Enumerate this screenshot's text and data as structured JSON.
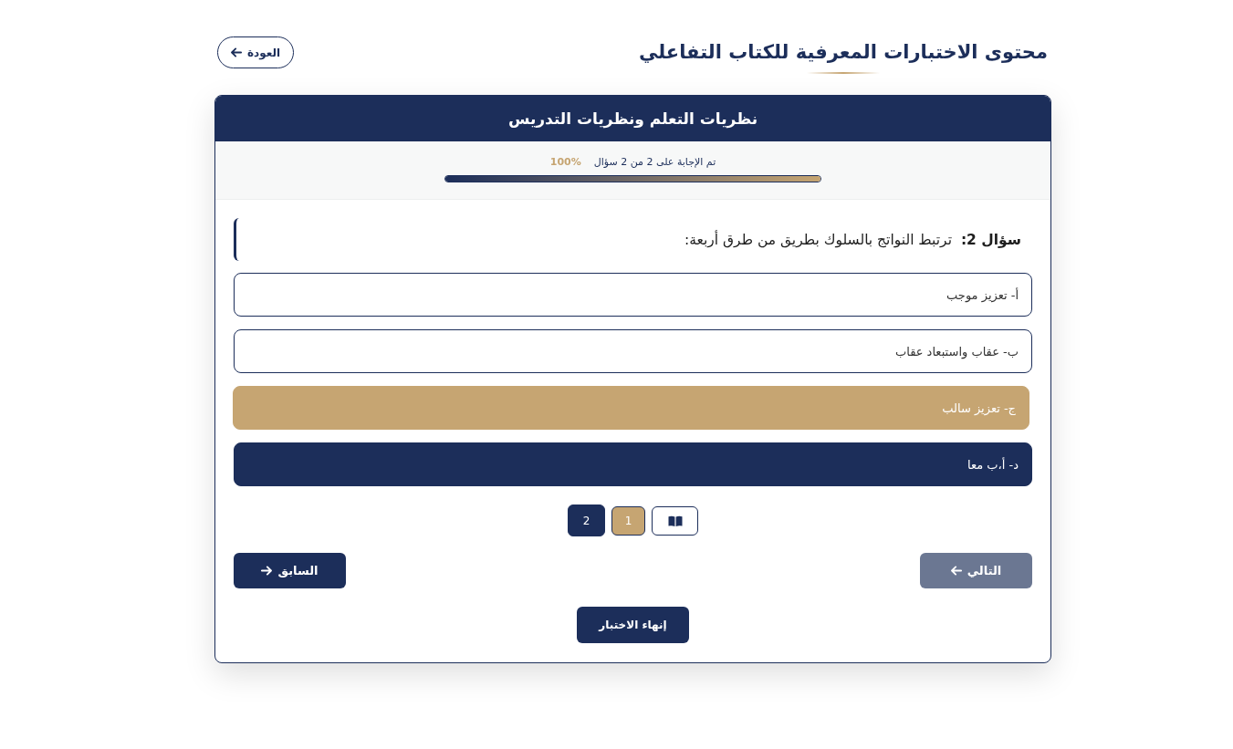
{
  "page": {
    "title": "محتوى الاختبارات المعرفية للكتاب التفاعلي",
    "back_button": {
      "label": "العودة"
    }
  },
  "quiz": {
    "title": "نظريات التعلم ونظريات التدريس",
    "progress": {
      "text": "تم الإجابة على 2 من 2 سؤال",
      "percent": "100%",
      "level": 1
    },
    "question": {
      "label": "سؤال 2:",
      "text": "ترتبط النواتج بالسلوك بطريق من طرق أربعة:"
    },
    "options": [
      {
        "label": "أ- تعزيز موجب",
        "selected": false,
        "highlighted": false
      },
      {
        "label": "ب- عقاب واستبعاد عقاب",
        "selected": false,
        "highlighted": false
      },
      {
        "label": "ج- تعزيز سالب",
        "selected": false,
        "highlighted": true
      },
      {
        "label": "د- أ،ب معا",
        "selected": true,
        "highlighted": false
      }
    ],
    "pagination": [
      {
        "kind": "book",
        "selected": false,
        "answered": false
      },
      {
        "kind": "number",
        "label": "1",
        "selected": false,
        "answered": true
      },
      {
        "kind": "number",
        "label": "2",
        "selected": true,
        "answered": true
      }
    ],
    "buttons": [
      {
        "kind": "next",
        "label": "التالي",
        "disabled": true
      },
      {
        "kind": "previous",
        "label": "السابق",
        "disabled": false
      }
    ],
    "finish_button": {
      "label": "إنهاء الاختبار"
    }
  }
}
